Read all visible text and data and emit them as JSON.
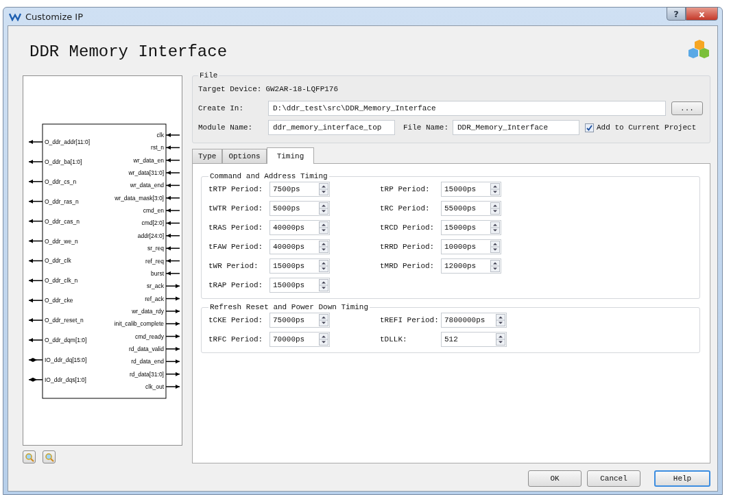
{
  "window": {
    "title": "Customize IP",
    "help_button": "?",
    "close_button": "x"
  },
  "header": {
    "title": "DDR Memory Interface"
  },
  "diagram": {
    "left_pins": [
      {
        "name": "O_ddr_addr[11:0]",
        "kind": "out"
      },
      {
        "name": "O_ddr_ba[1:0]",
        "kind": "out"
      },
      {
        "name": "O_ddr_cs_n",
        "kind": "out"
      },
      {
        "name": "O_ddr_ras_n",
        "kind": "out"
      },
      {
        "name": "O_ddr_cas_n",
        "kind": "out"
      },
      {
        "name": "O_ddr_we_n",
        "kind": "out"
      },
      {
        "name": "O_ddr_clk",
        "kind": "out"
      },
      {
        "name": "O_ddr_clk_n",
        "kind": "out"
      },
      {
        "name": "O_ddr_cke",
        "kind": "out"
      },
      {
        "name": "O_ddr_reset_n",
        "kind": "out"
      },
      {
        "name": "O_ddr_dqm[1:0]",
        "kind": "out"
      },
      {
        "name": "IO_ddr_dq[15:0]",
        "kind": "inout"
      },
      {
        "name": "IO_ddr_dqs[1:0]",
        "kind": "inout"
      }
    ],
    "right_pins": [
      {
        "name": "clk",
        "kind": "in"
      },
      {
        "name": "rst_n",
        "kind": "in"
      },
      {
        "name": "wr_data_en",
        "kind": "in"
      },
      {
        "name": "wr_data[31:0]",
        "kind": "in"
      },
      {
        "name": "wr_data_end",
        "kind": "in"
      },
      {
        "name": "wr_data_mask[3:0]",
        "kind": "in"
      },
      {
        "name": "cmd_en",
        "kind": "in"
      },
      {
        "name": "cmd[2:0]",
        "kind": "in"
      },
      {
        "name": "addr[24:0]",
        "kind": "in"
      },
      {
        "name": "sr_req",
        "kind": "in"
      },
      {
        "name": "ref_req",
        "kind": "in"
      },
      {
        "name": "burst",
        "kind": "in"
      },
      {
        "name": "sr_ack",
        "kind": "out"
      },
      {
        "name": "ref_ack",
        "kind": "out"
      },
      {
        "name": "wr_data_rdy",
        "kind": "out"
      },
      {
        "name": "init_calib_complete",
        "kind": "out"
      },
      {
        "name": "cmd_ready",
        "kind": "out"
      },
      {
        "name": "rd_data_valid",
        "kind": "out"
      },
      {
        "name": "rd_data_end",
        "kind": "out"
      },
      {
        "name": "rd_data[31:0]",
        "kind": "out"
      },
      {
        "name": "clk_out",
        "kind": "out"
      }
    ]
  },
  "file": {
    "legend": "File",
    "target_device_label": "Target Device:",
    "target_device": "GW2AR-18-LQFP176",
    "create_in_label": "Create In:",
    "create_in": "D:\\ddr_test\\src\\DDR_Memory_Interface",
    "browse_button": "...",
    "module_name_label": "Module Name:",
    "module_name": "ddr_memory_interface_top",
    "file_name_label": "File Name:",
    "file_name": "DDR_Memory_Interface",
    "add_to_project": {
      "label": "Add to Current Project",
      "checked": true
    }
  },
  "tabs": [
    {
      "label": "Type",
      "selected": false
    },
    {
      "label": "Options",
      "selected": false
    },
    {
      "label": "Timing",
      "selected": true
    }
  ],
  "groups": [
    {
      "legend": "Command and Address Timing",
      "fields": [
        {
          "label": "tRTP Period:",
          "value": "7500ps"
        },
        {
          "label": "tRP Period:",
          "value": "15000ps"
        },
        {
          "label": "tWTR Period:",
          "value": "5000ps"
        },
        {
          "label": "tRC Period:",
          "value": "55000ps"
        },
        {
          "label": "tRAS Period:",
          "value": "40000ps"
        },
        {
          "label": "tRCD Period:",
          "value": "15000ps"
        },
        {
          "label": "tFAW Period:",
          "value": "40000ps"
        },
        {
          "label": "tRRD Period:",
          "value": "10000ps"
        },
        {
          "label": "tWR Period:",
          "value": "15000ps"
        },
        {
          "label": "tMRD Period:",
          "value": "12000ps"
        },
        {
          "label": "tRAP Period:",
          "value": "15000ps"
        }
      ]
    },
    {
      "legend": "Refresh Reset and Power Down Timing",
      "fields": [
        {
          "label": "tCKE Period:",
          "value": "75000ps"
        },
        {
          "label": "tREFI Period:",
          "value": "7800000ps"
        },
        {
          "label": "tRFC Period:",
          "value": "70000ps"
        },
        {
          "label": "tDLLK:",
          "value": "512"
        }
      ]
    }
  ],
  "buttons": [
    {
      "label": "OK",
      "focused": false
    },
    {
      "label": "Cancel",
      "focused": false
    },
    {
      "label": "Help",
      "focused": true
    }
  ]
}
